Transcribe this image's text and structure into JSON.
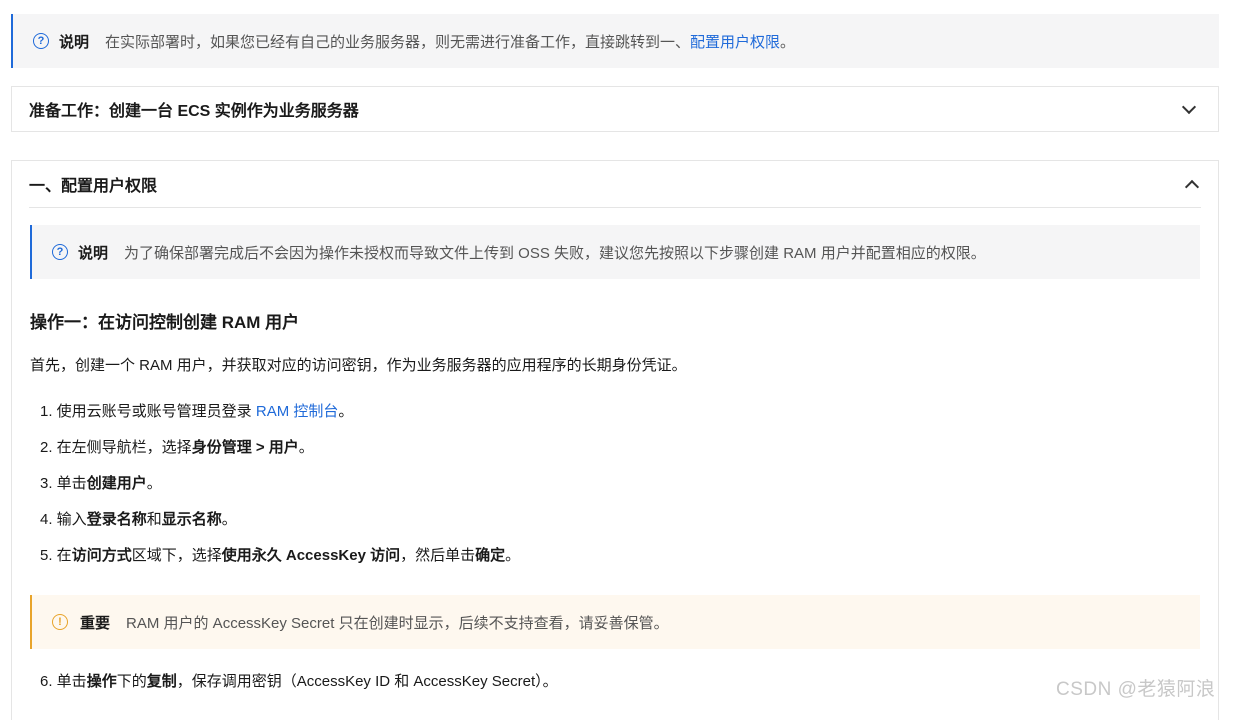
{
  "top_note": {
    "label": "说明",
    "text": "在实际部署时，如果您已经有自己的业务服务器，则无需进行准备工作，直接跳转到一、",
    "link": "配置用户权限",
    "tail": "。"
  },
  "prep_section": {
    "title": "准备工作：创建一台 ECS 实例作为业务服务器"
  },
  "section1": {
    "title": "一、配置用户权限",
    "note": {
      "label": "说明",
      "text": "为了确保部署完成后不会因为操作未授权而导致文件上传到 OSS 失败，建议您先按照以下步骤创建 RAM 用户并配置相应的权限。"
    },
    "heading": "操作一：在访问控制创建 RAM 用户",
    "intro": "首先，创建一个 RAM 用户，并获取对应的访问密钥，作为业务服务器的应用程序的长期身份凭证。",
    "steps": {
      "s1": {
        "prefix": "1. 使用云账号或账号管理员登录 ",
        "link": "RAM 控制台",
        "suffix": "。"
      },
      "s2": {
        "prefix": "2. 在左侧导航栏，选择",
        "bold1": "身份管理 > 用户",
        "suffix": "。"
      },
      "s3": {
        "prefix": "3. 单击",
        "bold1": "创建用户",
        "suffix": "。"
      },
      "s4": {
        "prefix": "4. 输入",
        "bold1": "登录名称",
        "mid": "和",
        "bold2": "显示名称",
        "suffix": "。"
      },
      "s5": {
        "prefix": "5. 在",
        "bold1": "访问方式",
        "mid": "区域下，选择",
        "bold2": "使用永久 AccessKey 访问",
        "mid2": "，然后单击",
        "bold3": "确定",
        "suffix": "。"
      },
      "s6": {
        "prefix": "6. 单击",
        "bold1": "操作",
        "mid": "下的",
        "bold2": "复制",
        "suffix": "，保存调用密钥（AccessKey ID 和 AccessKey Secret）。"
      }
    },
    "warning": {
      "label": "重要",
      "text": "RAM 用户的 AccessKey Secret 只在创建时显示，后续不支持查看，请妥善保管。"
    }
  },
  "watermark": "CSDN @老猿阿浪",
  "colors": {
    "accent": "#1f6ad9",
    "warning": "#e8a42b",
    "note_bg": "#f5f5f6",
    "warn_bg": "#fef8ef"
  },
  "icons": {
    "note": "question-circle-icon",
    "warning": "exclamation-circle-icon",
    "collapse": "chevron-icon"
  }
}
